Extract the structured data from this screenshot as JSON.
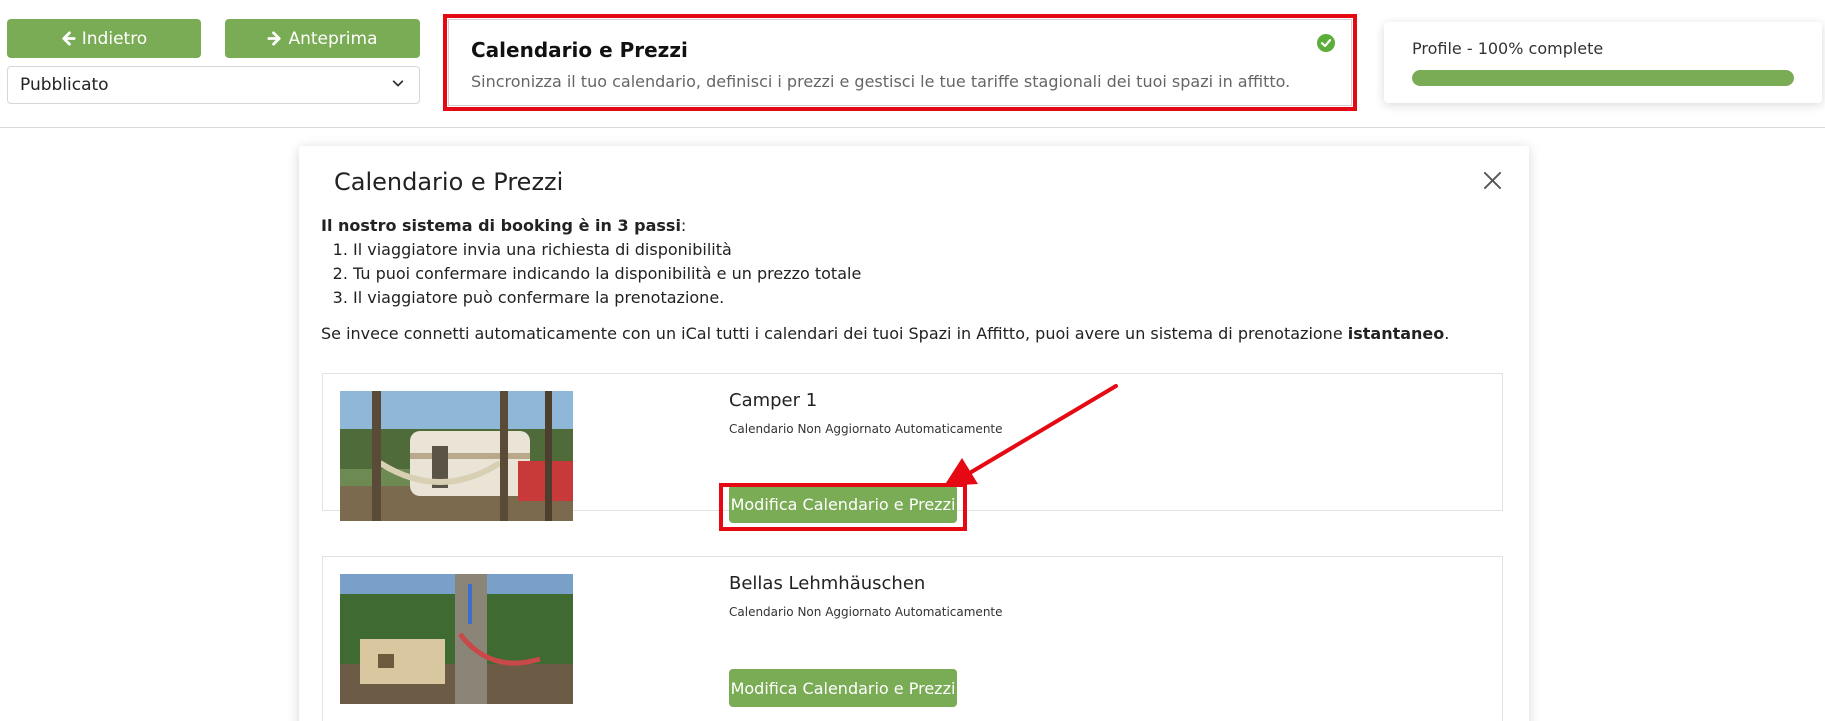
{
  "toolbar": {
    "back_label": "Indietro",
    "preview_label": "Anteprima",
    "status_value": "Pubblicato"
  },
  "section": {
    "title": "Calendario e Prezzi",
    "description": "Sincronizza il tuo calendario, definisci i prezzi e gestisci le tue tariffe stagionali dei tuoi spazi in affitto.",
    "completed": true
  },
  "profile": {
    "label": "Profile - 100% complete",
    "progress": 1.0
  },
  "modal": {
    "title": "Calendario e Prezzi",
    "intro_bold": "Il nostro sistema di booking è in 3 passi",
    "intro_colon": ":",
    "steps": [
      "Il viaggiatore invia una richiesta di disponibilità",
      "Tu puoi confermare indicando la disponibilità e un prezzo totale",
      "Il viaggiatore può confermare la prenotazione."
    ],
    "ical_text": "Se invece connetti automaticamente con un iCal tutti i calendari dei tuoi Spazi in Affitto, puoi avere un sistema di prenotazione ",
    "ical_bold": "istantaneo",
    "ical_end": "."
  },
  "spaces": [
    {
      "name": "Camper 1",
      "status": "Calendario Non Aggiornato Automaticamente",
      "button_label": "Modifica Calendario e Prezzi"
    },
    {
      "name": "Bellas Lehmhäuschen",
      "status": "Calendario Non Aggiornato Automaticamente",
      "button_label": "Modifica Calendario e Prezzi"
    }
  ],
  "colors": {
    "accent_green": "#7aab55",
    "highlight_red": "#e50914"
  },
  "icons": {
    "back": "arrow-left-icon",
    "preview": "arrow-right-icon",
    "select": "chevron-down-icon",
    "completed": "check-circle-icon",
    "close": "close-icon"
  }
}
